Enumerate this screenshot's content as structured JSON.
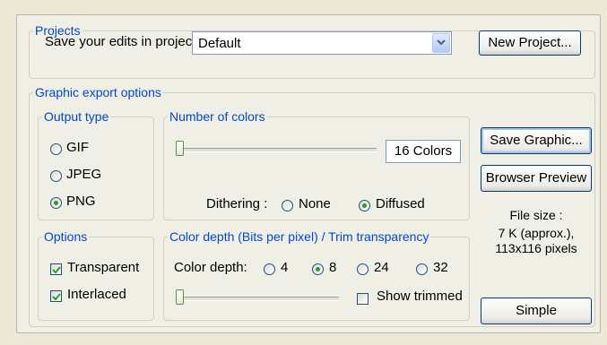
{
  "projects": {
    "legend": "Projects",
    "save_label": "Save your edits in project",
    "project_select": "Default",
    "new_project_button": "New Project..."
  },
  "export": {
    "legend": "Graphic export options",
    "output_type": {
      "legend": "Output type",
      "options": [
        "GIF",
        "JPEG",
        "PNG"
      ],
      "selected": "PNG"
    },
    "number_of_colors": {
      "legend": "Number of colors",
      "colors_value": "16 Colors",
      "dithering_label": "Dithering :",
      "dithering_options": [
        "None",
        "Diffused"
      ],
      "dithering_selected": "Diffused"
    },
    "options": {
      "legend": "Options",
      "transparent": {
        "label": "Transparent",
        "checked": true
      },
      "interlaced": {
        "label": "Interlaced",
        "checked": true
      }
    },
    "color_depth": {
      "legend": "Color depth (Bits per pixel) / Trim transparency",
      "depth_label": "Color depth:",
      "depth_options": [
        "4",
        "8",
        "24",
        "32"
      ],
      "depth_selected": "8",
      "show_trimmed": {
        "label": "Show trimmed",
        "checked": false
      }
    }
  },
  "buttons": {
    "save_graphic": "Save Graphic...",
    "browser_preview": "Browser Preview",
    "simple": "Simple"
  },
  "file_info": {
    "line1": "File size :",
    "line2": "7 K (approx.),",
    "line3": "113x116 pixels"
  },
  "colors": {
    "legend_blue": "#0046d5",
    "radio_selected": "#21a121",
    "check_green": "#21a121"
  }
}
